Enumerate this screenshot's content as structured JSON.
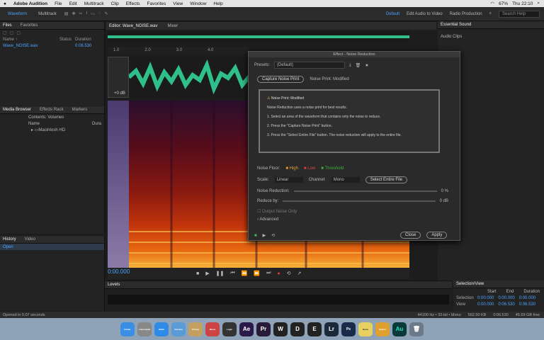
{
  "menubar": {
    "app": "Adobe Audition",
    "items": [
      "File",
      "Edit",
      "Multitrack",
      "Clip",
      "Effects",
      "Favorites",
      "View",
      "Window",
      "Help"
    ],
    "title": "Adobe Audition",
    "right": [
      "67%",
      "Thu 22:10"
    ]
  },
  "toolbar": {
    "waveform": "Waveform",
    "multitrack": "Multitrack",
    "workspaces": [
      "Default",
      "Edit Audio to Video",
      "Radio Production"
    ],
    "search": "Search Help"
  },
  "files": {
    "tabs": [
      "Files",
      "Favorites"
    ],
    "col_name": "Name ↑",
    "col_status": "Status",
    "col_duration": "Duration",
    "file": "Wave_NOISE.wav",
    "file_duration": "0:06.530"
  },
  "media": {
    "tabs": [
      "Media Browser",
      "Effects Rack",
      "Markers"
    ],
    "contents": "Contents: Volumes",
    "name_col": "Name",
    "dur_col": "Dura",
    "item": "Macintosh HD"
  },
  "history": {
    "tabs": [
      "History",
      "Video"
    ],
    "item": "Open"
  },
  "editor": {
    "tab": "Editor: Wave_NOISE.wav",
    "mixer": "Mixer",
    "timecode": "0:00.000",
    "hud": "+0 dB"
  },
  "ruler": [
    "1.0",
    "2.0",
    "3.0",
    "4.0"
  ],
  "levels": {
    "title": "Levels"
  },
  "selview": {
    "title": "Selection/View",
    "start": "Start",
    "end": "End",
    "duration": "Duration",
    "sel_label": "Selection",
    "view_label": "View",
    "sel_start": "0:00.000",
    "sel_end": "0:00.000",
    "sel_dur": "0:00.000",
    "view_start": "0:00.000",
    "view_end": "0:06.530",
    "view_dur": "0:06.530"
  },
  "status": {
    "left": "Opened in 0.07 seconds",
    "right": [
      "44100 Hz • 32-bit • Mono",
      "562.50 KB",
      "0:06.530",
      "45.59 GB free"
    ]
  },
  "essential": {
    "title": "Essential Sound",
    "sub": "Audio Clips"
  },
  "dialog": {
    "title": "Effect - Noise Reduction",
    "presets_label": "Presets:",
    "preset": "(Default)",
    "capture_btn": "Capture Noise Print",
    "noise_print": "Noise Print: Modified",
    "lines": [
      "Noise Print: Modified",
      "Noise Reduction uses a noise print for best results.",
      "1. Select an area of the waveform that contains only the noise to reduce.",
      "2. Press the \"Capture Noise Print\" button.",
      "3. Press the \"Select Entire File\" button. The noise reduction will apply to the entire file."
    ],
    "legend": [
      "Noise Floor:",
      "High",
      "Low",
      "Threshold"
    ],
    "scale_label": "Scale:",
    "scale": "Linear",
    "channel_label": "Channel:",
    "channel": "Mono",
    "select_btn": "Select Entire File",
    "nr_label": "Noise Reduction:",
    "nr_val": "0 %",
    "reduce_label": "Reduce by:",
    "reduce_val": "0 dB",
    "output_noise": "Output Noise Only",
    "advanced": "Advanced",
    "close": "Close",
    "apply": "Apply"
  },
  "dock": [
    "Finder",
    "Launchpad",
    "Safari",
    "Preview",
    "Photos",
    "Music",
    "Logic",
    "Ae",
    "Pr",
    "W",
    "D",
    "E",
    "Lr",
    "Ps",
    "Notes",
    "Sketch",
    "Au"
  ]
}
